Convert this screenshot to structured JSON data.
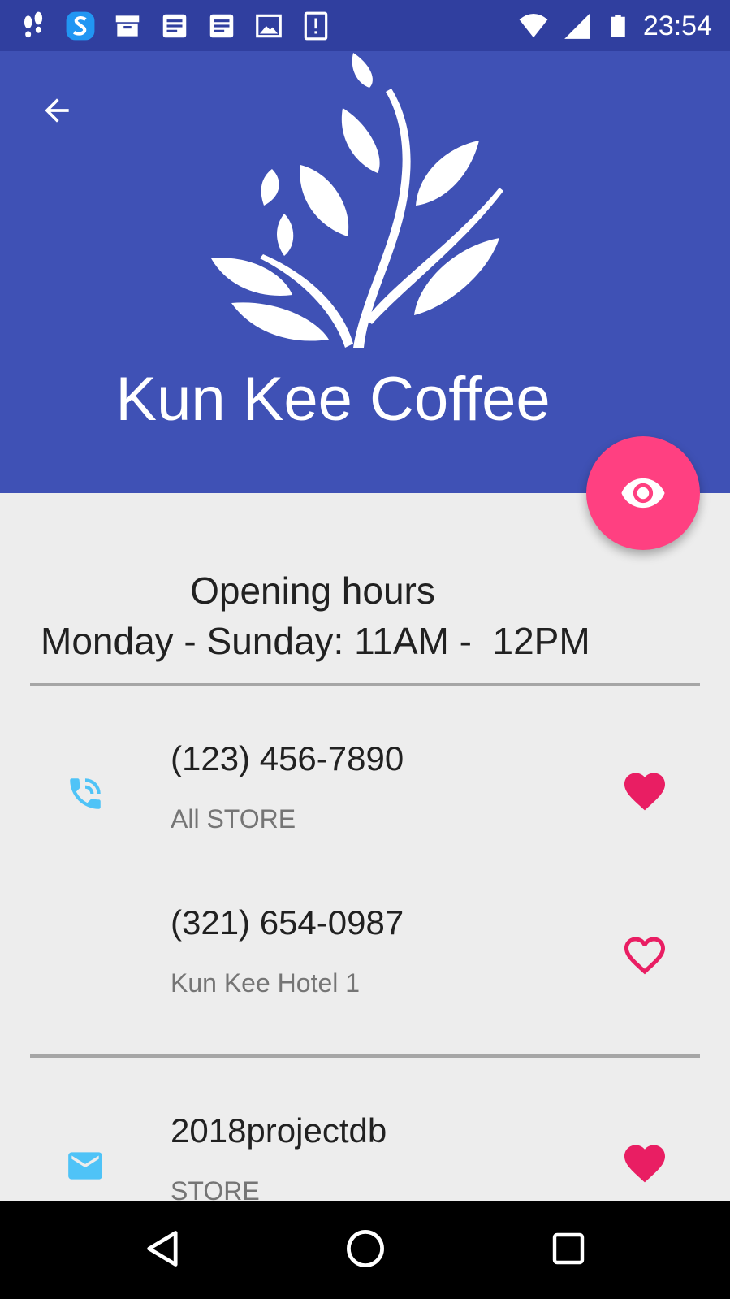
{
  "status_bar": {
    "time": "23:54",
    "left_icons": [
      "footprints-icon",
      "s-app-icon",
      "archive-icon",
      "document-icon",
      "document-icon",
      "image-icon",
      "alert-icon"
    ],
    "right_icons": [
      "wifi-icon",
      "signal-icon",
      "battery-icon"
    ]
  },
  "header": {
    "title": "Kun Kee Coffee",
    "back_icon": "arrow-back-icon",
    "logo": "leaf-tree-logo",
    "fab_icon": "eye-icon"
  },
  "hours": {
    "title": "Opening hours",
    "text": "Monday - Sunday: 11AM -  12PM"
  },
  "contacts": [
    {
      "icon": "phone-icon",
      "primary": "(123) 456-7890",
      "secondary": "All STORE",
      "favorite": true
    },
    {
      "icon": "",
      "primary": "(321) 654-0987",
      "secondary": "Kun Kee Hotel 1",
      "favorite": false
    },
    {
      "icon": "email-icon",
      "primary": "2018projectdb",
      "secondary": "STORE",
      "favorite": true
    }
  ],
  "colors": {
    "status_bar": "#303f9f",
    "primary": "#3f51b5",
    "accent": "#ff4081",
    "heart": "#e91e63",
    "contact_icon": "#4fc3f7",
    "background": "#ededed"
  },
  "nav_bar": {
    "buttons": [
      "back-triangle-icon",
      "home-circle-icon",
      "recents-square-icon"
    ]
  }
}
